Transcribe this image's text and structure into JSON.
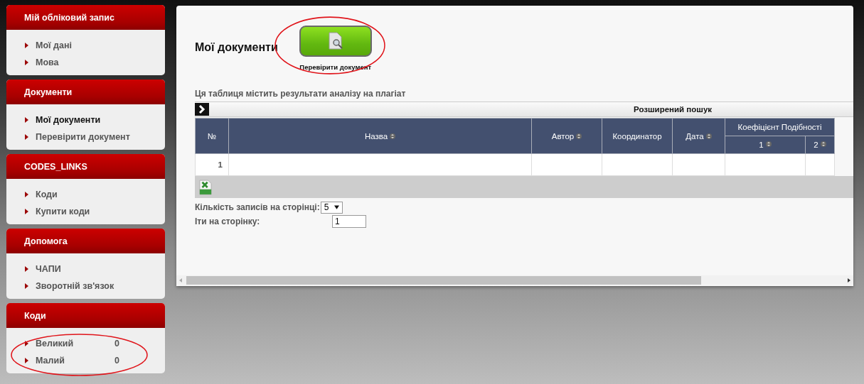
{
  "sidebar": [
    {
      "title": "Мій обліковий запис",
      "circled": false,
      "items": [
        {
          "label": "Мої дані",
          "selected": false
        },
        {
          "label": "Мова",
          "selected": false
        }
      ]
    },
    {
      "title": "Документи",
      "circled": false,
      "items": [
        {
          "label": "Мої документи",
          "selected": true
        },
        {
          "label": "Перевірити документ",
          "selected": false
        }
      ]
    },
    {
      "title": "CODES_LINKS",
      "circled": false,
      "items": [
        {
          "label": "Коди",
          "selected": false
        },
        {
          "label": "Купити коди",
          "selected": false
        }
      ]
    },
    {
      "title": "Допомога",
      "circled": false,
      "items": [
        {
          "label": "ЧАПИ",
          "selected": false
        },
        {
          "label": "Зворотній зв'язок",
          "selected": false
        }
      ]
    },
    {
      "title": "Коди",
      "circled": true,
      "items": [
        {
          "label": "Великий",
          "value": "0",
          "selected": false
        },
        {
          "label": "Малий",
          "value": "0",
          "selected": false
        }
      ]
    }
  ],
  "main": {
    "title": "Мої документи",
    "check_button": {
      "label": "Перевірити документ",
      "circled": true
    },
    "caption": "Ця таблиця містить результати аналізу на плагіат",
    "advanced_search": "Розширений пошук",
    "table": {
      "columns": [
        {
          "label": "№",
          "sortable": false
        },
        {
          "label": "Назва",
          "sortable": true
        },
        {
          "label": "Автор",
          "sortable": true
        },
        {
          "label": "Координатор",
          "sortable": false
        },
        {
          "label": "Дата",
          "sortable": true
        }
      ],
      "group": {
        "label": "Коефіцієнт  Подібності",
        "columns": [
          {
            "label": "1",
            "sortable": true
          },
          {
            "label": "2",
            "sortable": true
          }
        ]
      },
      "rows": [
        [
          "1",
          "",
          "",
          "",
          "",
          "",
          ""
        ]
      ]
    },
    "per_page": {
      "label": "Кількість записів на сторінці:",
      "value": "5"
    },
    "go_to_page": {
      "label": "Іти на сторінку:",
      "value": "1"
    }
  }
}
